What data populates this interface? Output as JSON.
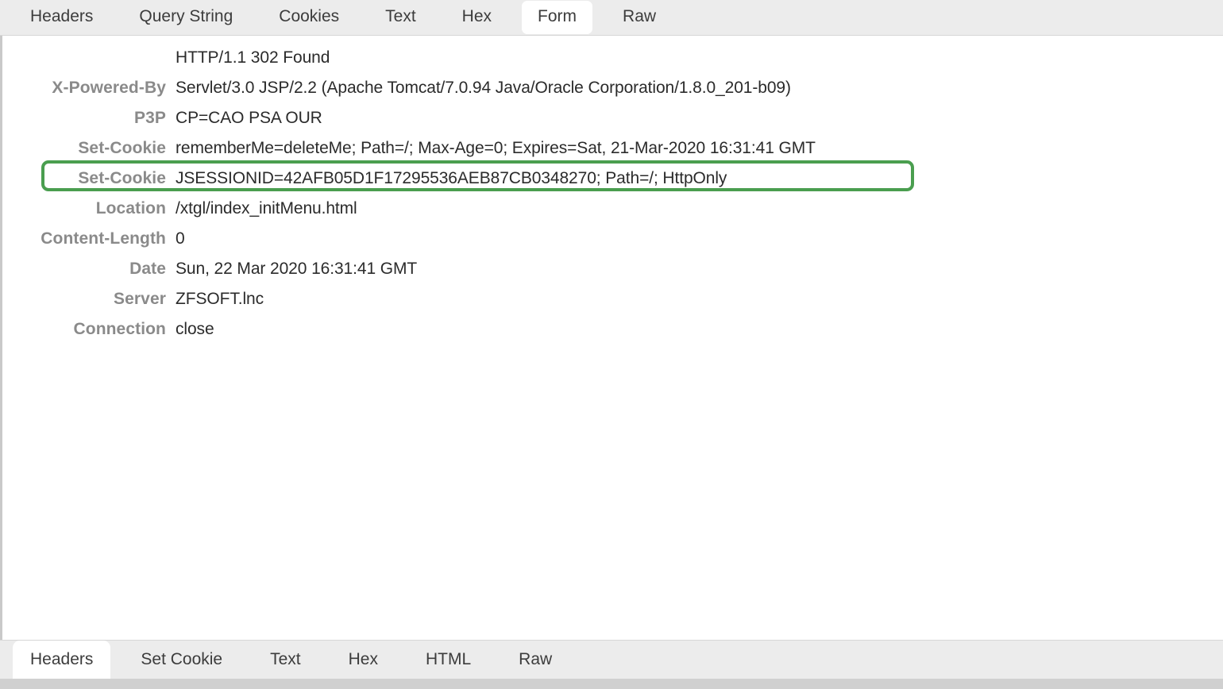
{
  "top_tabs": [
    {
      "label": "Headers",
      "active": false
    },
    {
      "label": "Query String",
      "active": false
    },
    {
      "label": "Cookies",
      "active": false
    },
    {
      "label": "Text",
      "active": false
    },
    {
      "label": "Hex",
      "active": false
    },
    {
      "label": "Form",
      "active": true
    },
    {
      "label": "Raw",
      "active": false
    }
  ],
  "bottom_tabs": [
    {
      "label": "Headers",
      "active": true
    },
    {
      "label": "Set Cookie",
      "active": false
    },
    {
      "label": "Text",
      "active": false
    },
    {
      "label": "Hex",
      "active": false
    },
    {
      "label": "HTML",
      "active": false
    },
    {
      "label": "Raw",
      "active": false
    }
  ],
  "headers": [
    {
      "name": "",
      "value": "HTTP/1.1 302 Found"
    },
    {
      "name": "X-Powered-By",
      "value": "Servlet/3.0 JSP/2.2 (Apache Tomcat/7.0.94 Java/Oracle Corporation/1.8.0_201-b09)"
    },
    {
      "name": "P3P",
      "value": "CP=CAO PSA OUR"
    },
    {
      "name": "Set-Cookie",
      "value": "rememberMe=deleteMe; Path=/; Max-Age=0; Expires=Sat, 21-Mar-2020 16:31:41 GMT"
    },
    {
      "name": "Set-Cookie",
      "value": "JSESSIONID=42AFB05D1F17295536AEB87CB0348270; Path=/; HttpOnly"
    },
    {
      "name": "Location",
      "value": "/xtgl/index_initMenu.html"
    },
    {
      "name": "Content-Length",
      "value": "0"
    },
    {
      "name": "Date",
      "value": "Sun, 22 Mar 2020 16:31:41 GMT"
    },
    {
      "name": "Server",
      "value": "ZFSOFT.lnc"
    },
    {
      "name": "Connection",
      "value": "close"
    }
  ],
  "annotation": {
    "target_row_index": 4,
    "color": "#4a9e4f",
    "shape": "rounded-rectangle-outline"
  },
  "colors": {
    "tabbar_bg": "#ececec",
    "active_tab_bg": "#ffffff",
    "panel_bg": "#ffffff",
    "label_text": "#8a8a8a",
    "value_text": "#2b2b2b",
    "highlight_green": "#4a9e4f",
    "bottom_strip": "#d0d0d0"
  }
}
